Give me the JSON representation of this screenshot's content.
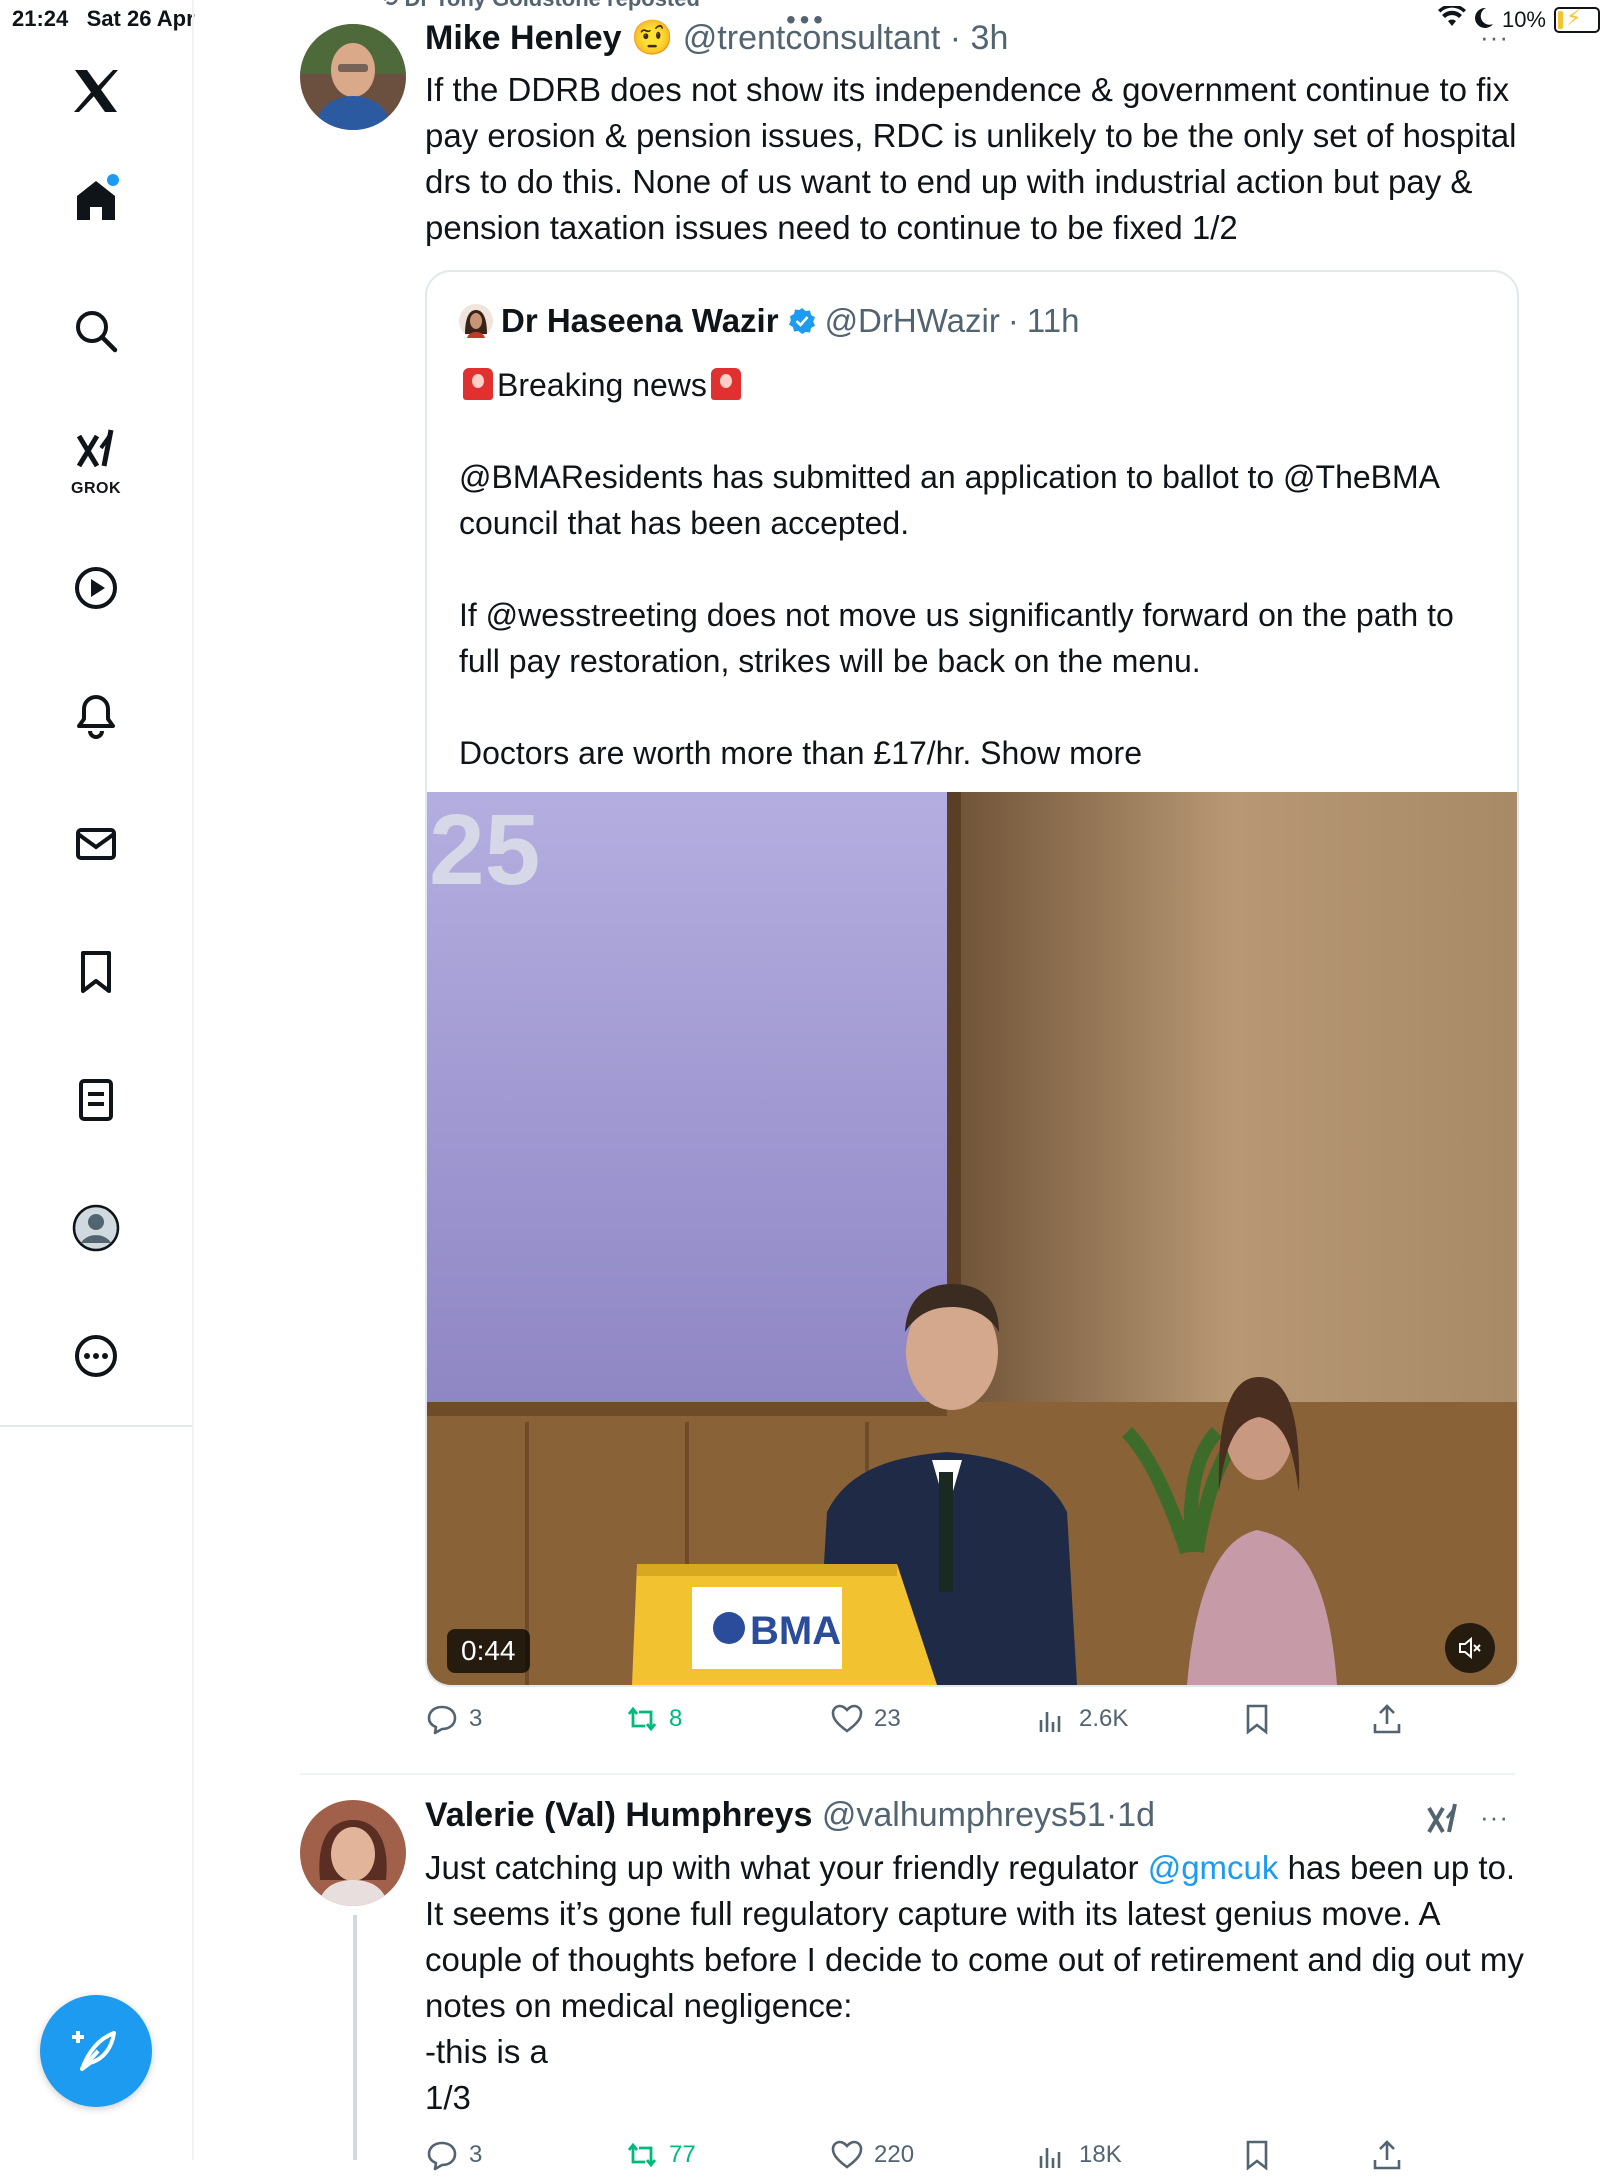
{
  "status_bar": {
    "time": "21:24",
    "date": "Sat 26 Apr",
    "battery": "10%"
  },
  "sidebar": {
    "items": [
      {
        "name": "home"
      },
      {
        "name": "explore"
      },
      {
        "name": "grok",
        "label": "GROK"
      },
      {
        "name": "videos"
      },
      {
        "name": "notifications"
      },
      {
        "name": "messages"
      },
      {
        "name": "bookmarks"
      },
      {
        "name": "lists"
      },
      {
        "name": "profile"
      },
      {
        "name": "more"
      }
    ]
  },
  "repost": {
    "text": "Dr Tony Goldstone reposted"
  },
  "tweet1": {
    "name": "Mike Henley",
    "emoji": "🤨",
    "handle": "@trentconsultant",
    "time": "3h",
    "text": "If the DDRB does not show its independence & government continue to fix pay erosion & pension issues, RDC is unlikely to be the only set of hospital drs to do this. None of us want to end up with industrial action but pay & pension taxation issues need to continue to be fixed 1/2",
    "quote": {
      "name": "Dr Haseena Wazir",
      "handle": "@DrHWazir",
      "time": "11h",
      "line1": "Breaking news",
      "para2": "@BMAResidents has submitted an application to ballot to @TheBMA council that has been accepted.",
      "para3": "If @wesstreeting does not move us significantly forward on the path to full pay restoration, strikes will be back on the menu.",
      "para4": "Doctors are worth more than £17/hr.",
      "show_more": "Show more",
      "video_duration": "0:44",
      "slide_text": "25",
      "podium_text": "BMA"
    },
    "stats": {
      "replies": "3",
      "reposts": "8",
      "likes": "23",
      "views": "2.6K"
    }
  },
  "tweet2": {
    "name": "Valerie (Val) Humphreys",
    "handle": "@valhumphreys51",
    "time": "1d",
    "text_pre": "Just catching up with what your friendly regulator ",
    "mention": "@gmcuk",
    "text_post": " has been up to. It seems it’s gone full regulatory capture with its latest genius move. A couple of thoughts before I decide to come out of retirement and dig out my notes on medical negligence:",
    "line2": "-this is a",
    "line3": "1/3",
    "stats": {
      "replies": "3",
      "reposts": "77",
      "likes": "220",
      "views": "18K"
    }
  },
  "colors": {
    "accent": "#1d9bf0",
    "repost_green": "#00ba7c",
    "text_secondary": "#536471"
  }
}
